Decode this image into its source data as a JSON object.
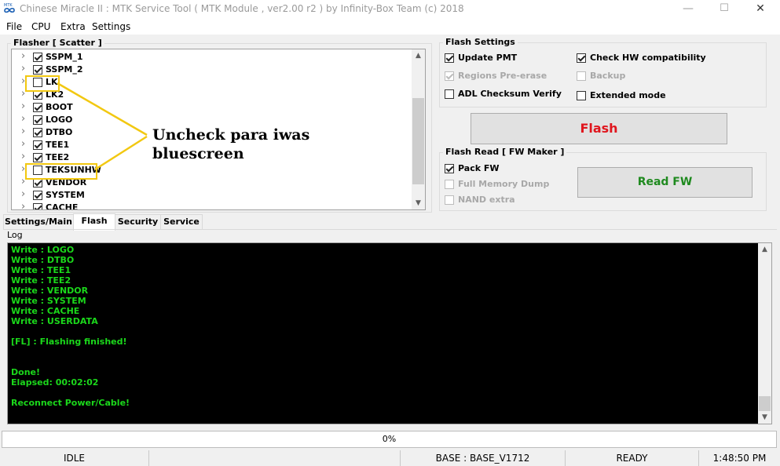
{
  "window": {
    "title": "Chinese Miracle II : MTK Service Tool ( MTK Module , ver2.00 r2  ) by Infinity-Box Team (c) 2018",
    "minimize": "—",
    "maximize": "☐",
    "close": "✕",
    "icon": "mtk-infinity-icon",
    "icon_text": "MTK"
  },
  "menu": [
    "File",
    "CPU",
    "Extra",
    "Settings"
  ],
  "flasher": {
    "title": "Flasher [ Scatter ]",
    "items": [
      {
        "label": "SSPM_1",
        "checked": true
      },
      {
        "label": "SSPM_2",
        "checked": true
      },
      {
        "label": "LK",
        "checked": false
      },
      {
        "label": "LK2",
        "checked": true
      },
      {
        "label": "BOOT",
        "checked": true
      },
      {
        "label": "LOGO",
        "checked": true
      },
      {
        "label": "DTBO",
        "checked": true
      },
      {
        "label": "TEE1",
        "checked": true
      },
      {
        "label": "TEE2",
        "checked": true
      },
      {
        "label": "TEKSUNHW",
        "checked": false
      },
      {
        "label": "VENDOR",
        "checked": true
      },
      {
        "label": "SYSTEM",
        "checked": true
      },
      {
        "label": "CACHE",
        "checked": true
      }
    ]
  },
  "annotation": {
    "line1": "Uncheck para iwas",
    "line2": "bluescreen",
    "color": "#f2c811"
  },
  "flash_settings": {
    "title": "Flash Settings",
    "options": [
      {
        "label": "Update PMT",
        "checked": true,
        "disabled": false
      },
      {
        "label": "Regions Pre-erase",
        "checked": true,
        "disabled": true
      },
      {
        "label": "ADL Checksum Verify",
        "checked": false,
        "disabled": false
      },
      {
        "label": "Check HW compatibility",
        "checked": true,
        "disabled": false
      },
      {
        "label": "Backup",
        "checked": false,
        "disabled": true
      },
      {
        "label": "Extended mode",
        "checked": false,
        "disabled": false
      }
    ],
    "flash_button": "Flash",
    "flash_color": "#e0161e"
  },
  "flash_read": {
    "title": "Flash Read [ FW Maker ]",
    "options": [
      {
        "label": "Pack FW",
        "checked": true,
        "disabled": false
      },
      {
        "label": "Full Memory Dump",
        "checked": false,
        "disabled": true
      },
      {
        "label": "NAND extra",
        "checked": false,
        "disabled": true
      }
    ],
    "read_button": "Read FW",
    "read_color": "#1f8a1f"
  },
  "tabs": [
    {
      "label": "Settings/Main",
      "active": false
    },
    {
      "label": "Flash",
      "active": true
    },
    {
      "label": "Security",
      "active": false
    },
    {
      "label": "Service",
      "active": false
    }
  ],
  "log": {
    "label": "Log",
    "lines": [
      "Write : LOGO",
      "Write : DTBO",
      "Write : TEE1",
      "Write : TEE2",
      "Write : VENDOR",
      "Write : SYSTEM",
      "Write : CACHE",
      "Write : USERDATA",
      "",
      "[FL] : Flashing finished!",
      "",
      "",
      "Done!",
      "Elapsed: 00:02:02",
      "",
      "Reconnect Power/Cable!"
    ],
    "text_color": "#1bd81b"
  },
  "progress": {
    "text": "0%",
    "value": 0
  },
  "status": {
    "state": "IDLE",
    "base": "BASE : BASE_V1712",
    "ready": "READY",
    "time": "1:48:50 PM"
  }
}
